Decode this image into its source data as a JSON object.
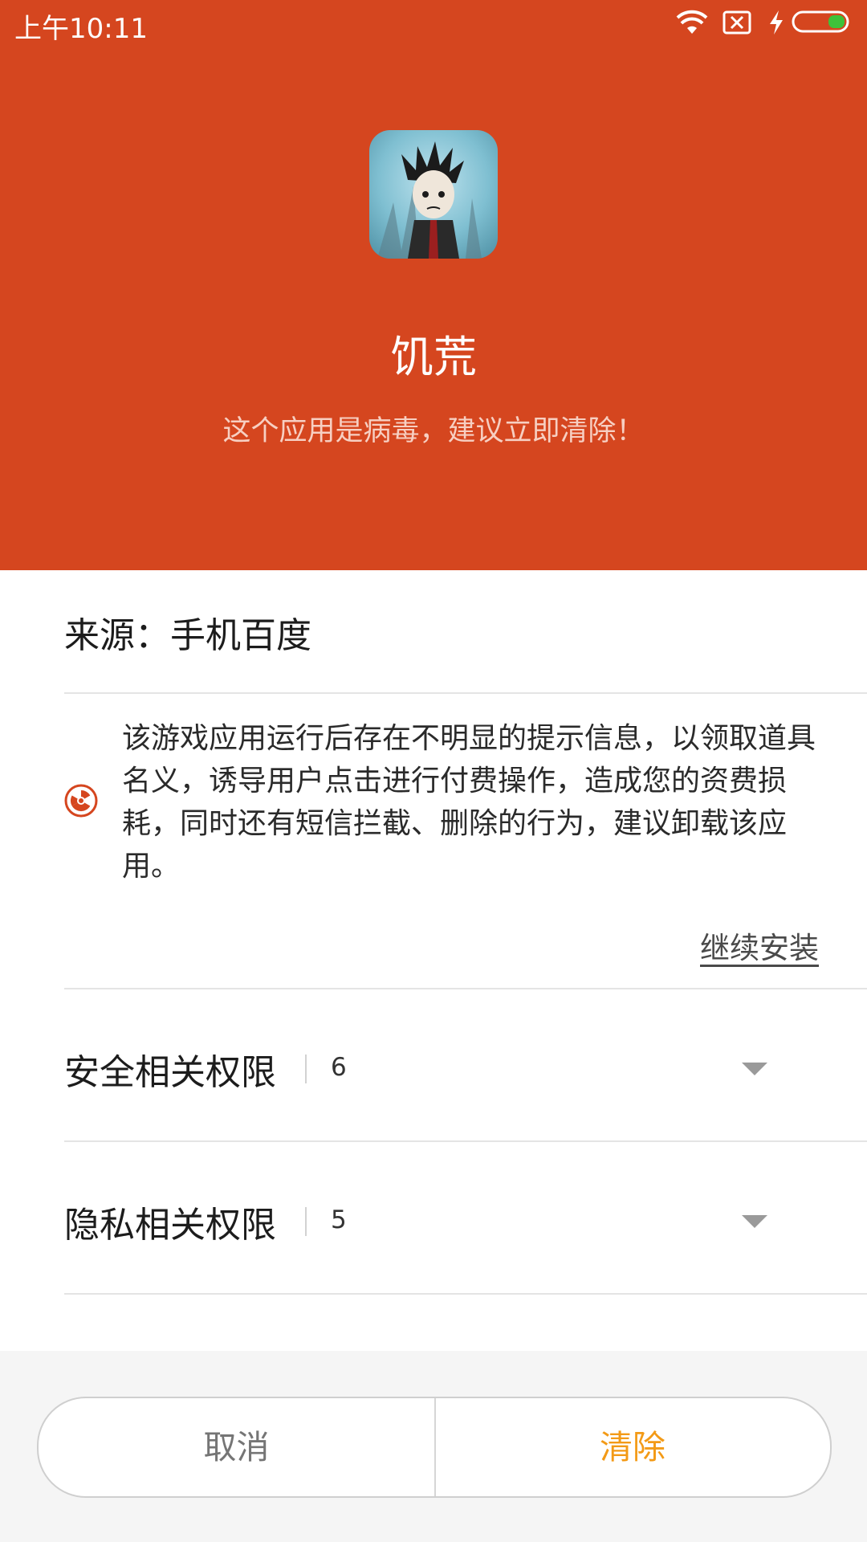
{
  "status_bar": {
    "time": "上午10:11",
    "icons": [
      "wifi-icon",
      "sim-blocked-icon",
      "charging-icon",
      "battery-icon"
    ]
  },
  "header": {
    "app_name": "饥荒",
    "warning": "这个应用是病毒，建议立即清除！",
    "background_color": "#d5461f"
  },
  "details": {
    "source": "来源：手机百度",
    "virus_description": "该游戏应用运行后存在不明显的提示信息，以领取道具名义，诱导用户点击进行付费操作，造成您的资费损耗，同时还有短信拦截、删除的行为，建议卸载该应用。",
    "continue_install": "继续安装"
  },
  "permissions": [
    {
      "label": "安全相关权限",
      "count": "6"
    },
    {
      "label": "隐私相关权限",
      "count": "5"
    }
  ],
  "actions": {
    "cancel": "取消",
    "clear": "清除",
    "clear_color": "#f39a16"
  }
}
